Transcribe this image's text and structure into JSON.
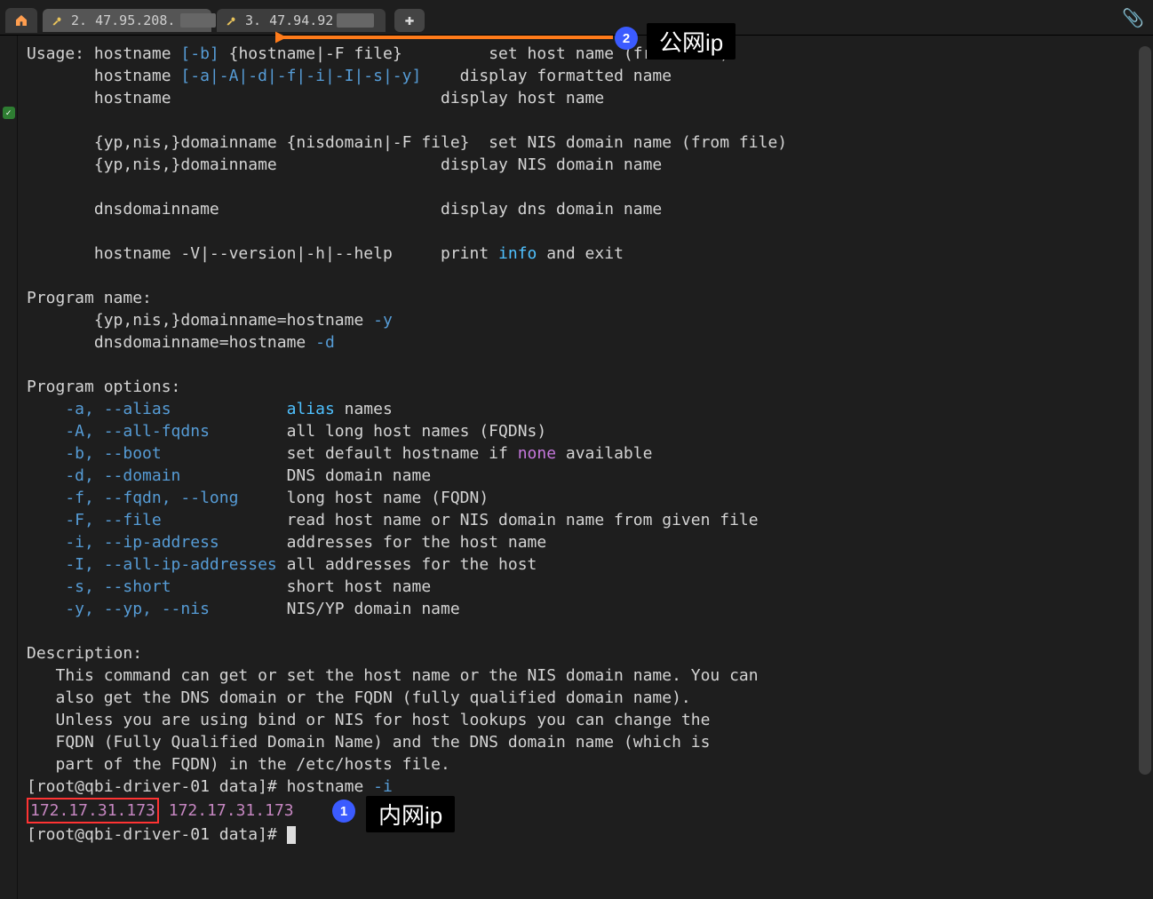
{
  "tabs": {
    "tab1_label": "2. 47.95.208.",
    "tab2_label": "3. 47.94.92",
    "new_tab_glyph": "✚",
    "close_glyph": "×"
  },
  "annotations": {
    "badge1": "1",
    "badge2": "2",
    "label_public": "公网ip",
    "label_private": "内网ip"
  },
  "term": {
    "usage_label": "Usage:",
    "u1_a": " hostname ",
    "u1_opt": "[-b]",
    "u1_b": " {hostname|-F file}         set host name (from file)",
    "u2_a": "       hostname ",
    "u2_opt": "[-a|-A|-d|-f|-i|-I|-s|-y]",
    "u2_b": "    display formatted name",
    "u3": "       hostname                            display host name",
    "u5": "       {yp,nis,}domainname {nisdomain|-F file}  set NIS domain name (from file)",
    "u6": "       {yp,nis,}domainname                 display NIS domain name",
    "u8": "       dnsdomainname                       display dns domain name",
    "u10_a": "       hostname -V|--version|-h|--help     print ",
    "u10_kw": "info",
    "u10_b": " and exit",
    "pn_title": "Program name:",
    "pn1_a": "       {yp,nis,}domainname=hostname ",
    "pn1_opt": "-y",
    "pn2_a": "       dnsdomainname=hostname ",
    "pn2_opt": "-d",
    "po_title": "Program options:",
    "po_a_opt": "    -a, --alias",
    "po_a_mid": "            ",
    "po_a_kw": "alias",
    "po_a_txt": " names",
    "po_A_opt": "    -A, --all-fqdns",
    "po_A_txt": "        all long host names (FQDNs)",
    "po_b_opt": "    -b, --boot",
    "po_b_txt": "             set default hostname if ",
    "po_b_kw": "none",
    "po_b_end": " available",
    "po_d_opt": "    -d, --domain",
    "po_d_txt": "           DNS domain name",
    "po_f_opt": "    -f, --fqdn, --long",
    "po_f_txt": "     long host name (FQDN)",
    "po_F_opt": "    -F, --file",
    "po_F_txt": "             read host name or NIS domain name from given file",
    "po_i_opt": "    -i, --ip-address",
    "po_i_txt": "       addresses for the host name",
    "po_I_opt": "    -I, --all-ip-addresses",
    "po_I_txt": " all addresses for the host",
    "po_s_opt": "    -s, --short",
    "po_s_txt": "            short host name",
    "po_y_opt": "    -y, --yp, --nis",
    "po_y_txt": "        NIS/YP domain name",
    "desc_title": "Description:",
    "desc1": "   This command can get or set the host name or the NIS domain name. You can",
    "desc2": "   also get the DNS domain or the FQDN (fully qualified domain name).",
    "desc3": "   Unless you are using bind or NIS for host lookups you can change the",
    "desc4": "   FQDN (Fully Qualified Domain Name) and the DNS domain name (which is",
    "desc5": "   part of the FQDN) in the /etc/hosts file.",
    "prompt1_a": "[root@qbi-driver-01 data]# hostname ",
    "prompt1_opt": "-i",
    "ip1": "172.17.31.173",
    "ip_sep": " ",
    "ip2": "172.17.31.173",
    "prompt2": "[root@qbi-driver-01 data]# "
  }
}
